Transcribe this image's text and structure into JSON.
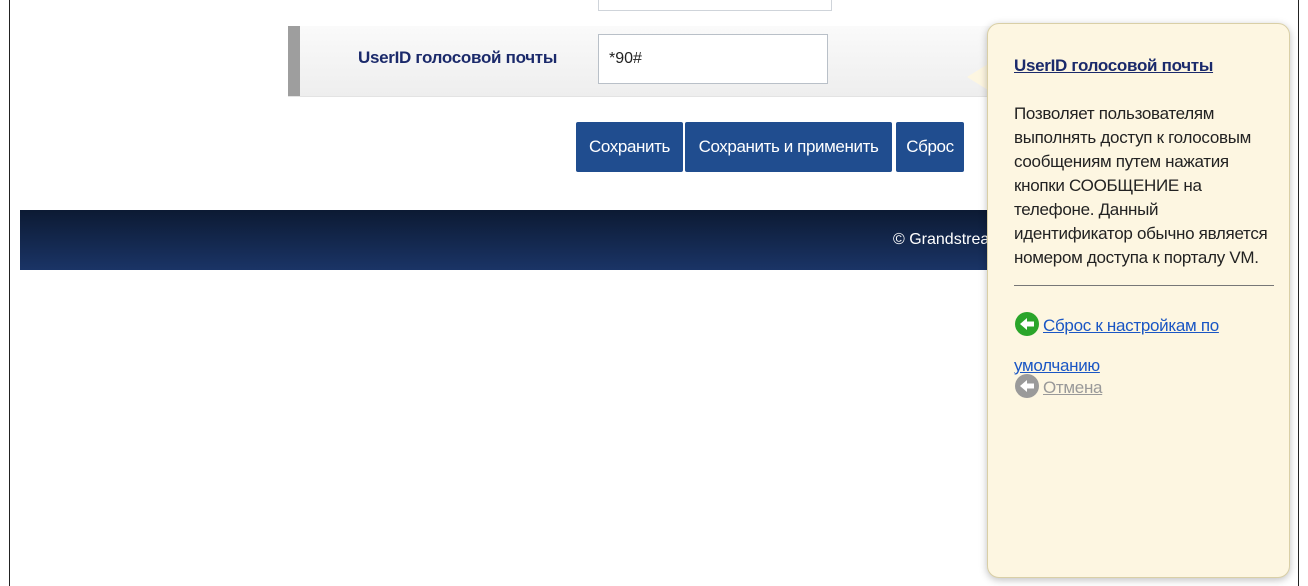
{
  "form": {
    "voicemail_userid": {
      "label": "UserID голосовой почты",
      "value": "*90#"
    }
  },
  "actions": {
    "save_label": "Сохранить",
    "save_apply_label": "Сохранить и применить",
    "reset_label": "Сброс"
  },
  "footer": {
    "copyright": "© Grandstrea"
  },
  "tooltip": {
    "title": "UserID голосовой почты",
    "description": "Позволяет пользователям выполнять доступ к голосовым сообщениям путем нажатия кнопки СООБЩЕНИЕ на телефоне. Данный идентификатор обычно является номером доступа к порталу VM.",
    "reset_default_link": "Сброс к настройкам по умолчанию",
    "cancel_link": "Отмена"
  },
  "colors": {
    "button_bg": "#204d8f",
    "label_text": "#1b2a6b",
    "tooltip_bg": "#fdf6e1",
    "link": "#1a56c4",
    "reset_icon": "#2aa52a",
    "cancel_icon": "#9a9a9a"
  },
  "icons": {
    "reset": "arrow-left-circle-icon",
    "cancel": "arrow-left-circle-icon"
  }
}
